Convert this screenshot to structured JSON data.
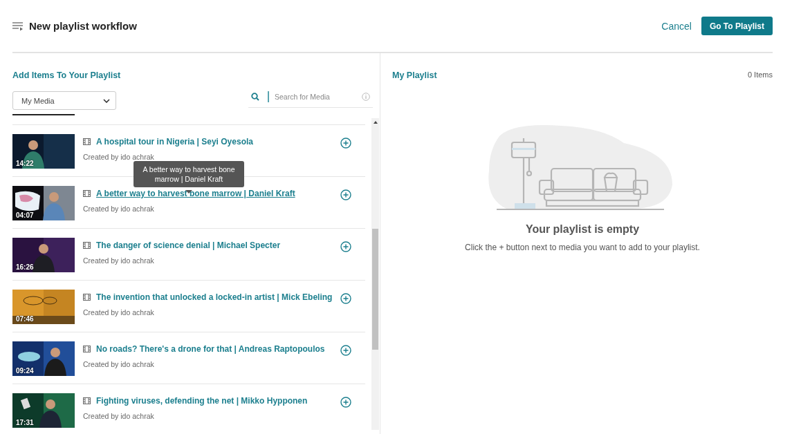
{
  "header": {
    "title": "New playlist workflow",
    "cancel": "Cancel",
    "primary": "Go To Playlist"
  },
  "add_panel": {
    "title": "Add Items To Your Playlist",
    "source": "My Media",
    "search": {
      "placeholder": "Search for Media"
    },
    "items": [
      {
        "title": "A hospital tour in Nigeria | Seyi Oyesola",
        "creator": "Created by ido achrak",
        "duration": "14:22",
        "hovered": false
      },
      {
        "title": "A better way to harvest bone marrow | Daniel Kraft",
        "creator": "Created by ido achrak",
        "duration": "04:07",
        "hovered": true,
        "tooltip": "A better way to harvest bone marrow | Daniel Kraft"
      },
      {
        "title": "The danger of science denial | Michael Specter",
        "creator": "Created by ido achrak",
        "duration": "16:26",
        "hovered": false
      },
      {
        "title": "The invention that unlocked a locked-in artist | Mick Ebeling",
        "creator": "Created by ido achrak",
        "duration": "07:46",
        "hovered": false
      },
      {
        "title": "No roads? There's a drone for that | Andreas Raptopoulos",
        "creator": "Created by ido achrak",
        "duration": "09:24",
        "hovered": false
      },
      {
        "title": "Fighting viruses, defending the net | Mikko Hypponen",
        "creator": "Created by ido achrak",
        "duration": "17:31",
        "hovered": false
      }
    ]
  },
  "playlist_panel": {
    "title": "My Playlist",
    "count": "0 Items",
    "empty_title": "Your playlist is empty",
    "empty_hint": "Click the + button next to media you want to add to your playlist."
  }
}
